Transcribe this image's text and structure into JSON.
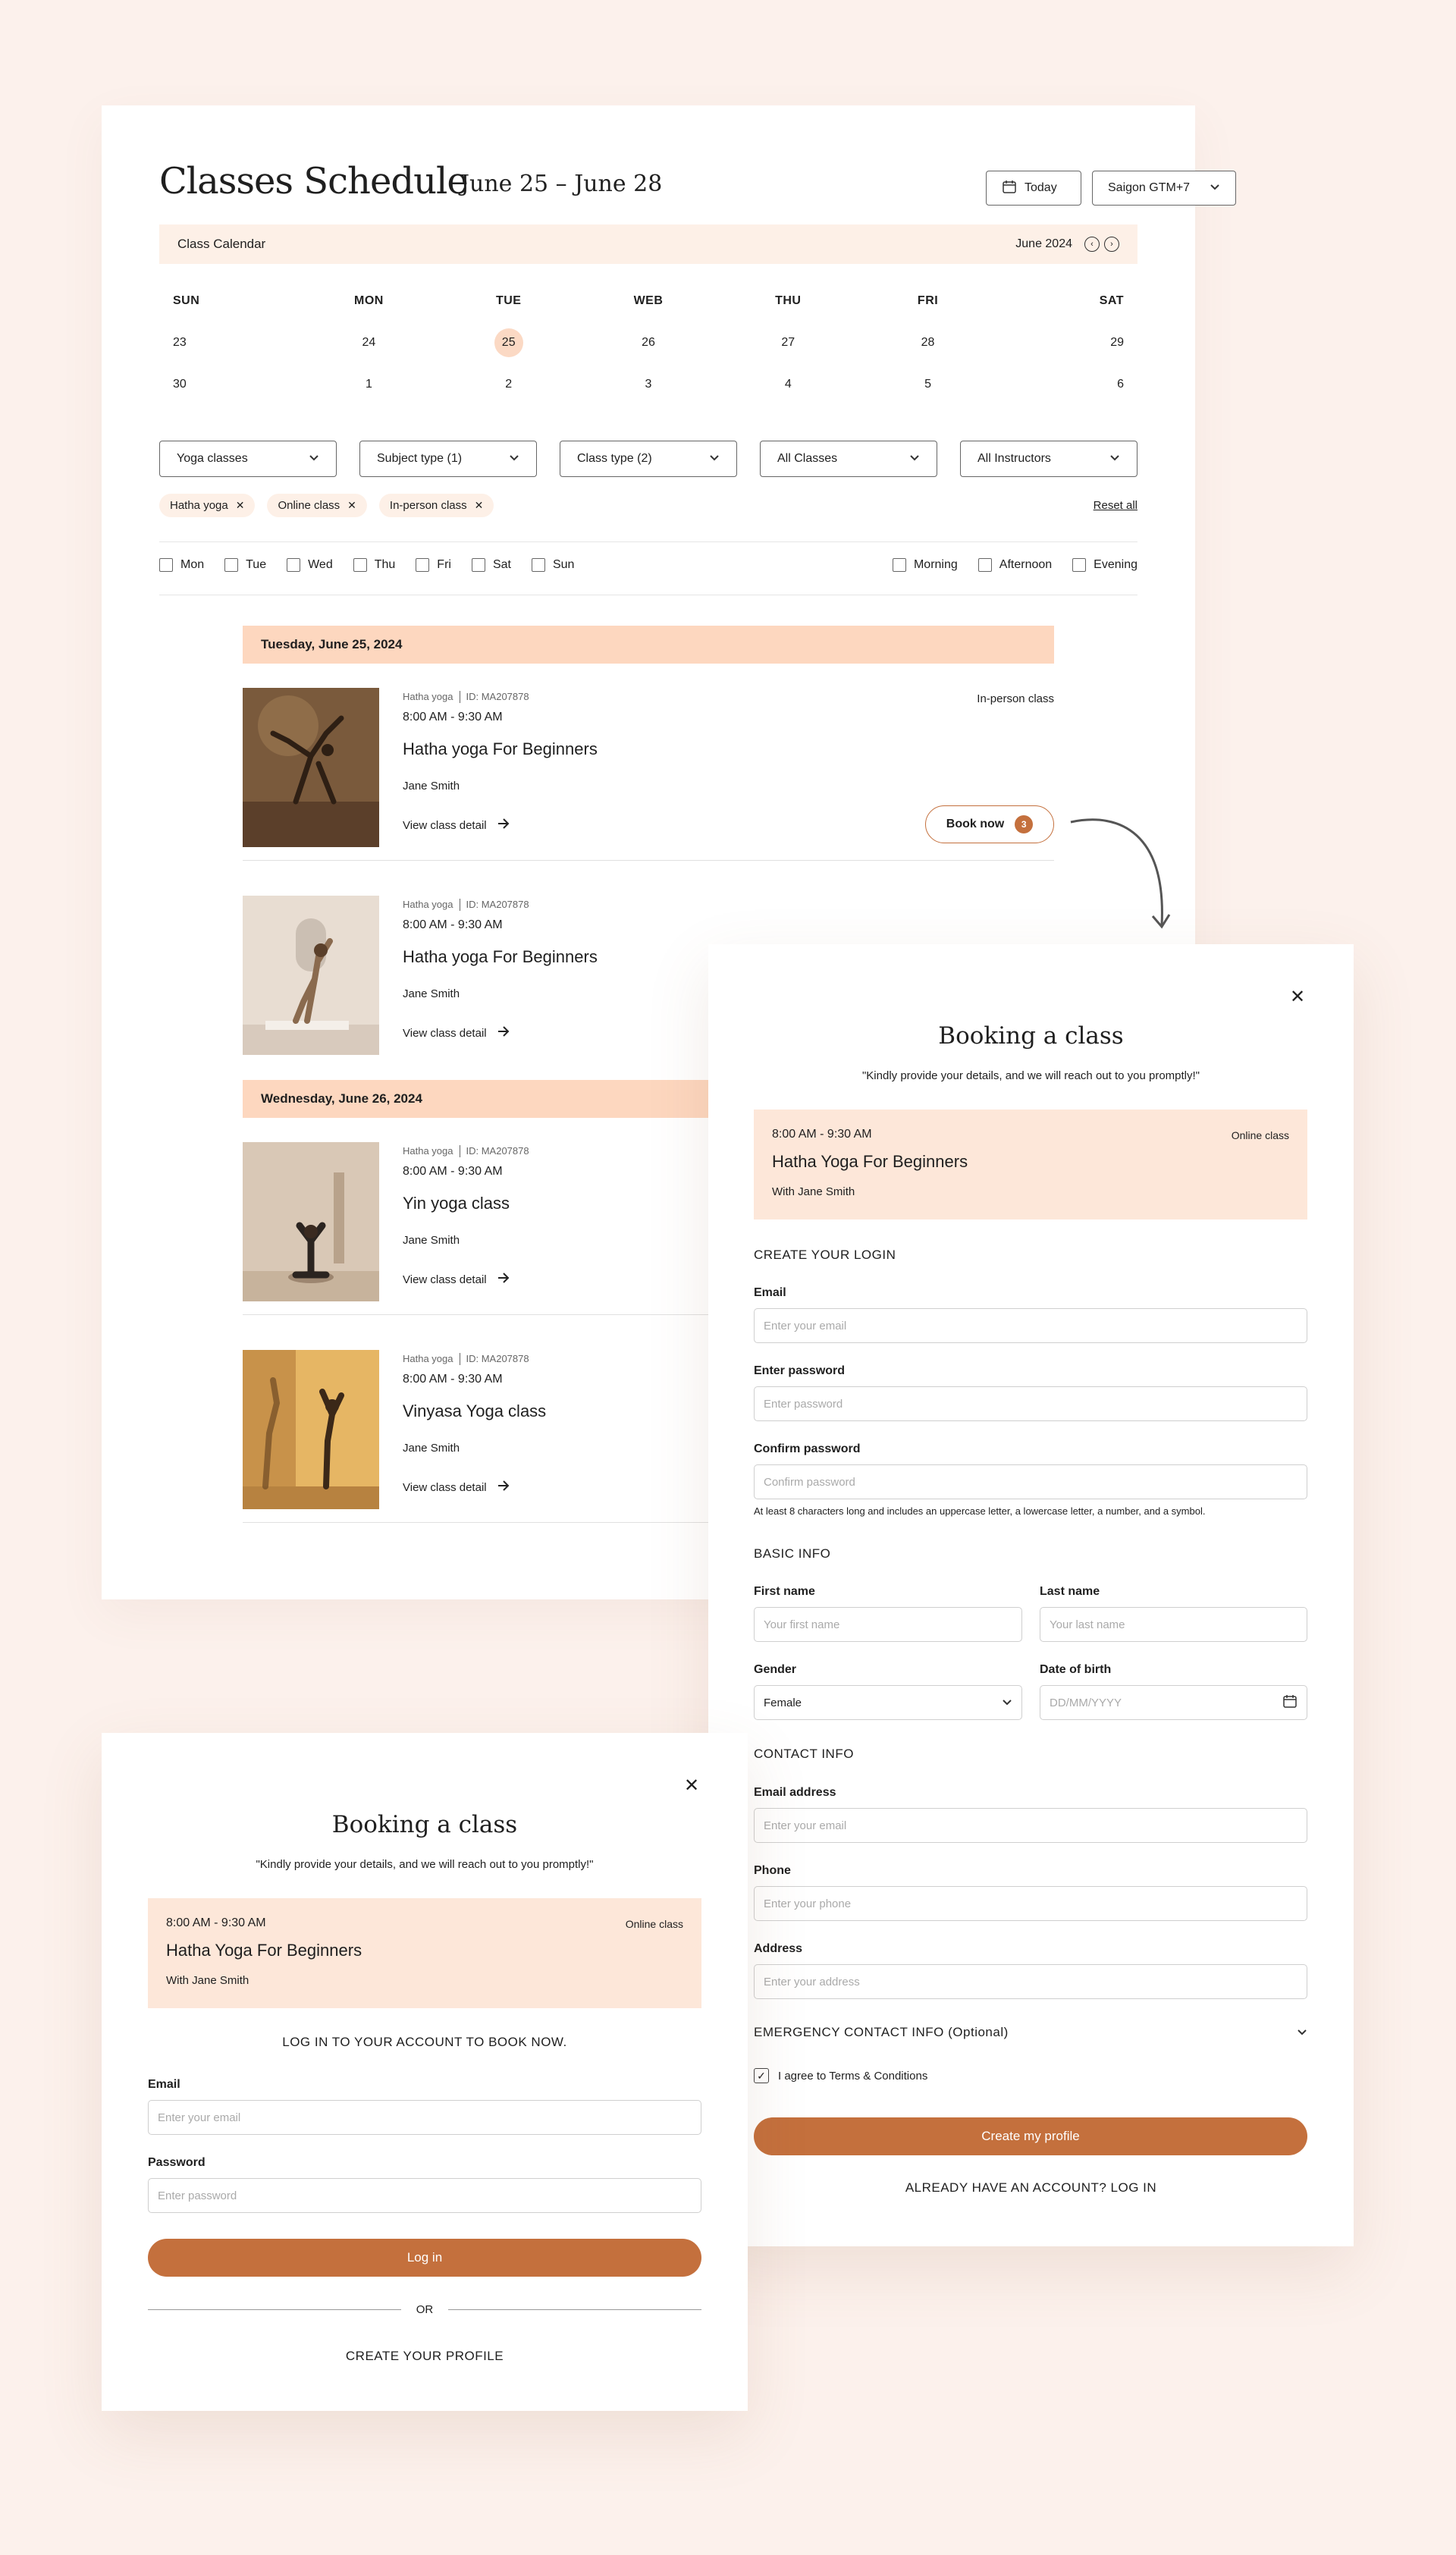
{
  "schedule": {
    "title": "Classes Schedule",
    "range": "June 25 – June 28",
    "today_label": "Today",
    "timezone": "Saigon GTM+7",
    "calendar_label": "Class Calendar",
    "month_label": "June 2024",
    "weekdays": [
      "SUN",
      "MON",
      "TUE",
      "WEB",
      "THU",
      "FRI",
      "SAT"
    ],
    "weeks": [
      [
        "23",
        "24",
        "25",
        "26",
        "27",
        "28",
        "29"
      ],
      [
        "30",
        "1",
        "2",
        "3",
        "4",
        "5",
        "6"
      ]
    ],
    "selected_day": "25",
    "filters": [
      "Yoga classes",
      "Subject type (1)",
      "Class type (2)",
      "All Classes",
      "All Instructors"
    ],
    "chips": [
      "Hatha yoga",
      "Online class",
      "In-person class"
    ],
    "reset_label": "Reset all",
    "day_checks": [
      "Mon",
      "Tue",
      "Wed",
      "Thu",
      "Fri",
      "Sat",
      "Sun"
    ],
    "time_checks": [
      "Morning",
      "Afternoon",
      "Evening"
    ],
    "date_bands": [
      "Tuesday, June 25, 2024",
      "Wednesday, June 26, 2024"
    ],
    "classes": [
      {
        "category": "Hatha yoga",
        "id": "ID: MA207878",
        "time": "8:00 AM - 9:30 AM",
        "name": "Hatha yoga For Beginners",
        "instructor": "Jane Smith",
        "link": "View class detail",
        "type": "In-person class",
        "book": "Book now",
        "badge": "3"
      },
      {
        "category": "Hatha yoga",
        "id": "ID: MA207878",
        "time": "8:00 AM - 9:30 AM",
        "name": "Hatha yoga For Beginners",
        "instructor": "Jane Smith",
        "link": "View class detail"
      },
      {
        "category": "Hatha yoga",
        "id": "ID: MA207878",
        "time": "8:00 AM - 9:30 AM",
        "name": "Yin yoga class",
        "instructor": "Jane Smith",
        "link": "View class detail"
      },
      {
        "category": "Hatha yoga",
        "id": "ID: MA207878",
        "time": "8:00 AM - 9:30 AM",
        "name": "Vinyasa Yoga class",
        "instructor": "Jane Smith",
        "link": "View class detail"
      }
    ]
  },
  "signup_modal": {
    "title": "Booking a class",
    "quote": "\"Kindly provide your details, and we will reach out to you promptly!\"",
    "class": {
      "time": "8:00 AM - 9:30 AM",
      "type": "Online class",
      "name": "Hatha Yoga For Beginners",
      "with": "With Jane Smith"
    },
    "login_section": "CREATE YOUR LOGIN",
    "email_label": "Email",
    "email_ph": "Enter your email",
    "password_label": "Enter password",
    "password_ph": "Enter password",
    "confirm_label": "Confirm password",
    "confirm_ph": "Confirm password",
    "password_hint": "At least 8 characters long and includes an uppercase letter, a lowercase letter, a number, and a symbol.",
    "basic_section": "BASIC INFO",
    "first_label": "First name",
    "first_ph": "Your first name",
    "last_label": "Last name",
    "last_ph": "Your last name",
    "gender_label": "Gender",
    "gender_value": "Female",
    "dob_label": "Date of birth",
    "dob_ph": "DD/MM/YYYY",
    "contact_section": "CONTACT INFO",
    "contact_email_label": "Email address",
    "contact_email_ph": "Enter your email",
    "phone_label": "Phone",
    "phone_ph": "Enter your phone",
    "address_label": "Address",
    "address_ph": "Enter your address",
    "emergency_label": "EMERGENCY CONTACT INFO (Optional)",
    "terms_label": "I agree to Terms & Conditions",
    "submit_label": "Create my profile",
    "login_link": "ALREADY HAVE AN ACCOUNT? LOG IN"
  },
  "login_modal": {
    "title": "Booking a class",
    "quote": "\"Kindly provide your details, and we will reach out to you promptly!\"",
    "class": {
      "time": "8:00 AM - 9:30 AM",
      "type": "Online class",
      "name": "Hatha Yoga For Beginners",
      "with": "With Jane Smith"
    },
    "heading": "LOG IN TO YOUR ACCOUNT TO BOOK NOW.",
    "email_label": "Email",
    "email_ph": "Enter your email",
    "password_label": "Password",
    "password_ph": "Enter password",
    "submit_label": "Log in",
    "or_label": "OR",
    "create_label": "CREATE YOUR PROFILE"
  },
  "colors": {
    "accent": "#c4703d",
    "band": "#fdd7bf",
    "page_bg": "#fcf1ec"
  }
}
